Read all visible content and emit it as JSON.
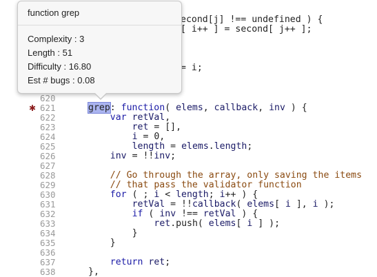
{
  "tooltip": {
    "title": "function grep",
    "stats": [
      {
        "label": "Complexity : 3"
      },
      {
        "label": "Length : 51"
      },
      {
        "label": "Difficulty : 16.80"
      },
      {
        "label": "Est # bugs : 0.08"
      }
    ]
  },
  "code_fragments": {
    "top1": "econd[j] !== undefined ) {",
    "top2": "[ i++ ] = second[ j++ ];",
    "top3": "= i;"
  },
  "lines": [
    {
      "num": "620",
      "text": ""
    },
    {
      "num": "621",
      "text": "grep: function( elems, callback, inv ) {"
    },
    {
      "num": "622",
      "text": "    var retVal,"
    },
    {
      "num": "623",
      "text": "        ret = [],"
    },
    {
      "num": "624",
      "text": "        i = 0,"
    },
    {
      "num": "625",
      "text": "        length = elems.length;"
    },
    {
      "num": "626",
      "text": "    inv = !!inv;"
    },
    {
      "num": "627",
      "text": ""
    },
    {
      "num": "628",
      "text": "    // Go through the array, only saving the items"
    },
    {
      "num": "629",
      "text": "    // that pass the validator function"
    },
    {
      "num": "630",
      "text": "    for ( ; i < length; i++ ) {"
    },
    {
      "num": "631",
      "text": "        retVal = !!callback( elems[ i ], i );"
    },
    {
      "num": "632",
      "text": "        if ( inv !== retVal ) {"
    },
    {
      "num": "633",
      "text": "            ret.push( elems[ i ] );"
    },
    {
      "num": "634",
      "text": "        }"
    },
    {
      "num": "635",
      "text": "    }"
    },
    {
      "num": "636",
      "text": ""
    },
    {
      "num": "637",
      "text": "    return ret;"
    },
    {
      "num": "638",
      "text": "},"
    }
  ],
  "highlight": "grep",
  "marker_icon": "gear-icon"
}
